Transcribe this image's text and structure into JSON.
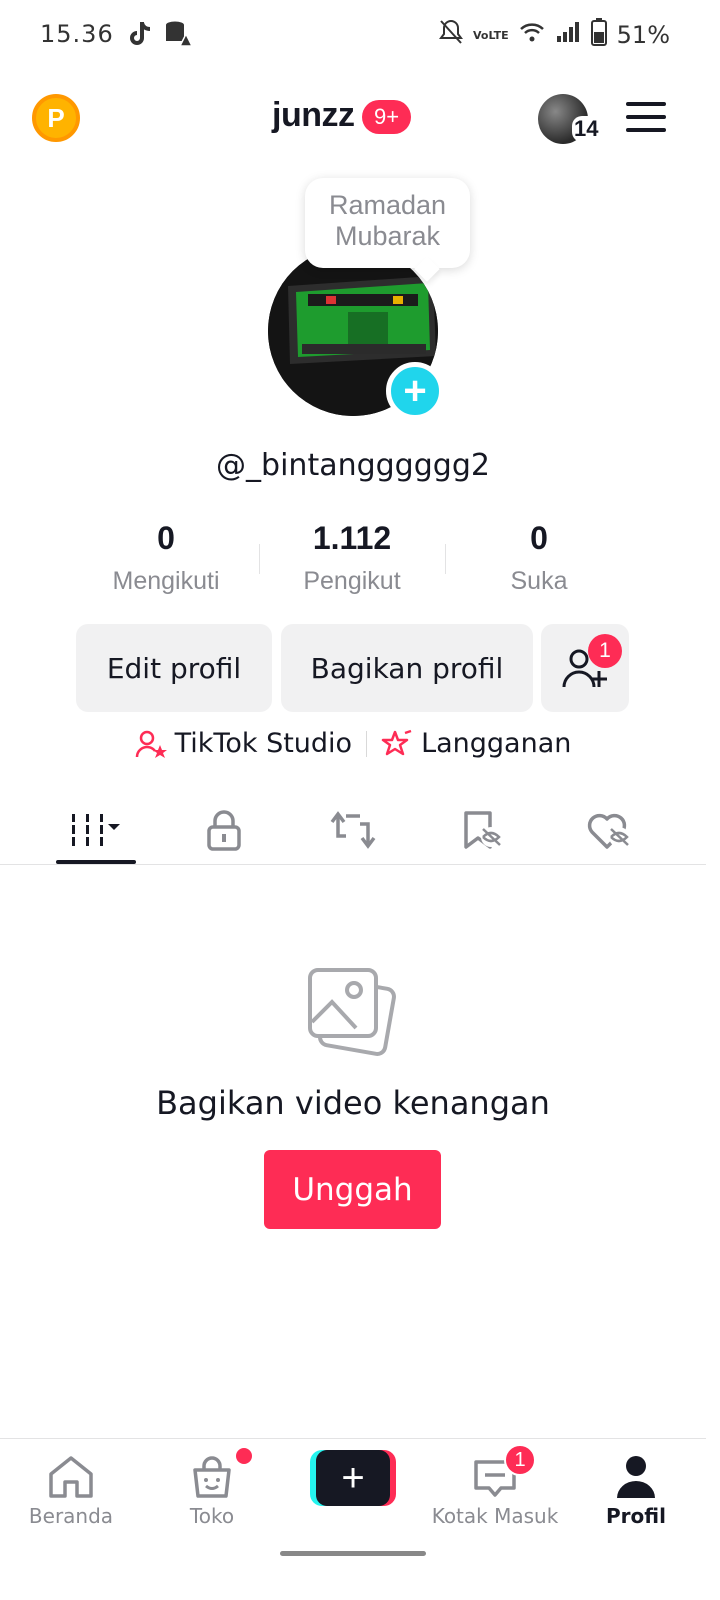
{
  "status_bar": {
    "time": "15.36",
    "battery": "51%"
  },
  "header": {
    "brand": "junzz",
    "brand_badge": "9+",
    "avatar_count": "14"
  },
  "profile": {
    "bubble_line1": "Ramadan",
    "bubble_line2": "Mubarak",
    "username": "@_bintangggggg2"
  },
  "stats": [
    {
      "value": "0",
      "label": "Mengikuti"
    },
    {
      "value": "1.112",
      "label": "Pengikut"
    },
    {
      "value": "0",
      "label": "Suka"
    }
  ],
  "buttons": {
    "edit": "Edit profil",
    "share": "Bagikan profil",
    "add_friend_badge": "1"
  },
  "links": {
    "studio": "TikTok Studio",
    "subscription": "Langganan"
  },
  "empty_state": {
    "title": "Bagikan video kenangan",
    "upload": "Unggah"
  },
  "nav": {
    "home": "Beranda",
    "shop": "Toko",
    "inbox": "Kotak Masuk",
    "inbox_badge": "1",
    "profile": "Profil"
  },
  "icons": [
    "tiktok-icon",
    "database-warning-icon",
    "mute-icon",
    "volte-icon",
    "wifi-icon",
    "signal-icon",
    "battery-icon",
    "coin-icon",
    "menu-icon",
    "plus-icon",
    "grid-icon",
    "lock-icon",
    "repost-icon",
    "bookmark-hidden-icon",
    "heart-hidden-icon",
    "photos-icon",
    "home-icon",
    "shop-icon",
    "inbox-icon",
    "person-icon"
  ],
  "colors": {
    "accent": "#fe2c55",
    "cyan": "#25f4ee",
    "add_avatar": "#20d5ec"
  }
}
